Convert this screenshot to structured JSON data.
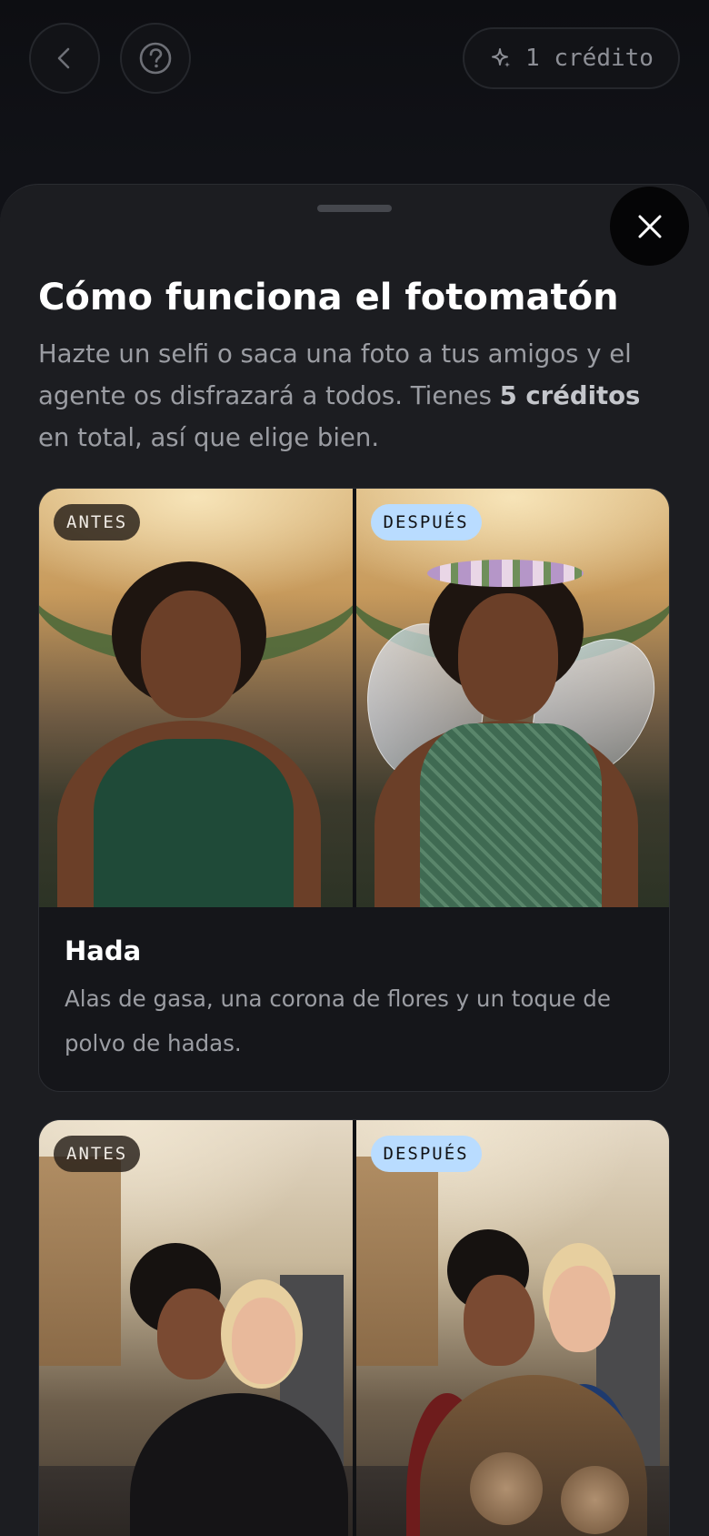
{
  "topbar": {
    "back_icon": "chevron-left-icon",
    "help_icon": "question-circle-icon",
    "credits_icon": "sparkle-icon",
    "credits_label": "1 crédito"
  },
  "sheet": {
    "close_icon": "close-icon",
    "title": "Cómo funciona el fotomatón",
    "description_before": "Hazte un selfi o saca una foto a tus amigos y el agente os disfrazará a todos. Tienes ",
    "description_bold": "5 créditos",
    "description_after": " en total, así que elige bien."
  },
  "cards": [
    {
      "before_badge": "ANTES",
      "after_badge": "DESPUÉS",
      "title": "Hada",
      "text": "Alas de gasa, una corona de flores y un toque de polvo de hadas."
    },
    {
      "before_badge": "ANTES",
      "after_badge": "DESPUÉS",
      "title": "",
      "text": ""
    }
  ],
  "colors": {
    "background": "#0c0d11",
    "sheet": "#1c1d21",
    "after_badge": "#b9dcff"
  }
}
